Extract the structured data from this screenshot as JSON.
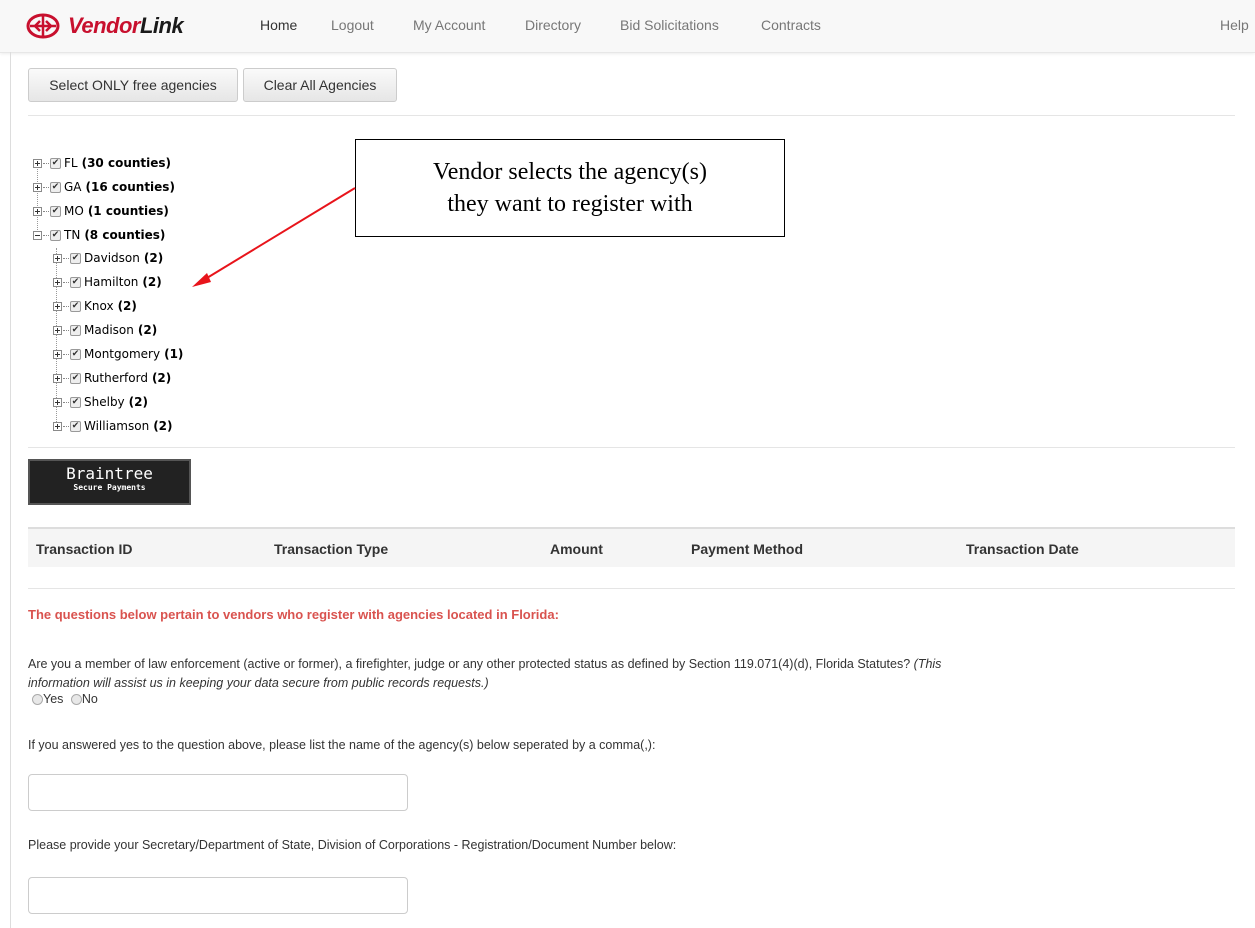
{
  "nav": {
    "brand_vendor": "Vendor",
    "brand_link": "Link",
    "brand_icon": "vendorlink-globe-logo",
    "items": [
      {
        "label": "Home"
      },
      {
        "label": "Logout"
      },
      {
        "label": "My Account"
      },
      {
        "label": "Directory"
      },
      {
        "label": "Bid Solicitations"
      },
      {
        "label": "Contracts"
      }
    ],
    "help": "Help"
  },
  "toolbar": {
    "select_free_label": "Select ONLY free agencies",
    "clear_all_label": "Clear All Agencies"
  },
  "tree": {
    "states": [
      {
        "name": "FL",
        "count": "(30 counties)",
        "expanded": false,
        "checked": true
      },
      {
        "name": "GA",
        "count": "(16 counties)",
        "expanded": false,
        "checked": true
      },
      {
        "name": "MO",
        "count": "(1 counties)",
        "expanded": false,
        "checked": true
      },
      {
        "name": "TN",
        "count": "(8 counties)",
        "expanded": true,
        "checked": true
      }
    ],
    "counties": [
      {
        "name": "Davidson",
        "count": "(2)",
        "checked": true
      },
      {
        "name": "Hamilton",
        "count": "(2)",
        "checked": true
      },
      {
        "name": "Knox",
        "count": "(2)",
        "checked": true
      },
      {
        "name": "Madison",
        "count": "(2)",
        "checked": true
      },
      {
        "name": "Montgomery",
        "count": "(1)",
        "checked": true
      },
      {
        "name": "Rutherford",
        "count": "(2)",
        "checked": true
      },
      {
        "name": "Shelby",
        "count": "(2)",
        "checked": true
      },
      {
        "name": "Williamson",
        "count": "(2)",
        "checked": true
      }
    ]
  },
  "callout": {
    "line1": "Vendor selects the agency(s)",
    "line2": "they want to register with",
    "arrow_color": "#e8141b"
  },
  "braintree": {
    "title": "Braintree",
    "subtitle": "Secure Payments"
  },
  "transactions": {
    "columns": [
      "Transaction ID",
      "Transaction Type",
      "Amount",
      "Payment Method",
      "Transaction Date"
    ],
    "rows": []
  },
  "questions": {
    "heading": "The questions below pertain to vendors who register with agencies located in Florida:",
    "heading_color": "#d9534f",
    "q1_text": "Are you a member of law enforcement (active or former), a firefighter, judge or any other protected status as defined by Section 119.071(4)(d), Florida Statutes?",
    "q1_note_a": "(This",
    "q1_note_b": "information will assist us in keeping your data secure from public records requests.)",
    "q1_yes": "Yes",
    "q1_no": "No",
    "q2_text": "If you answered yes to the question above, please list the name of the agency(s) below seperated by a comma(,):",
    "q2_value": "",
    "q3_text": "Please provide your Secretary/Department of State, Division of Corporations - Registration/Document Number below:",
    "q3_value": ""
  }
}
